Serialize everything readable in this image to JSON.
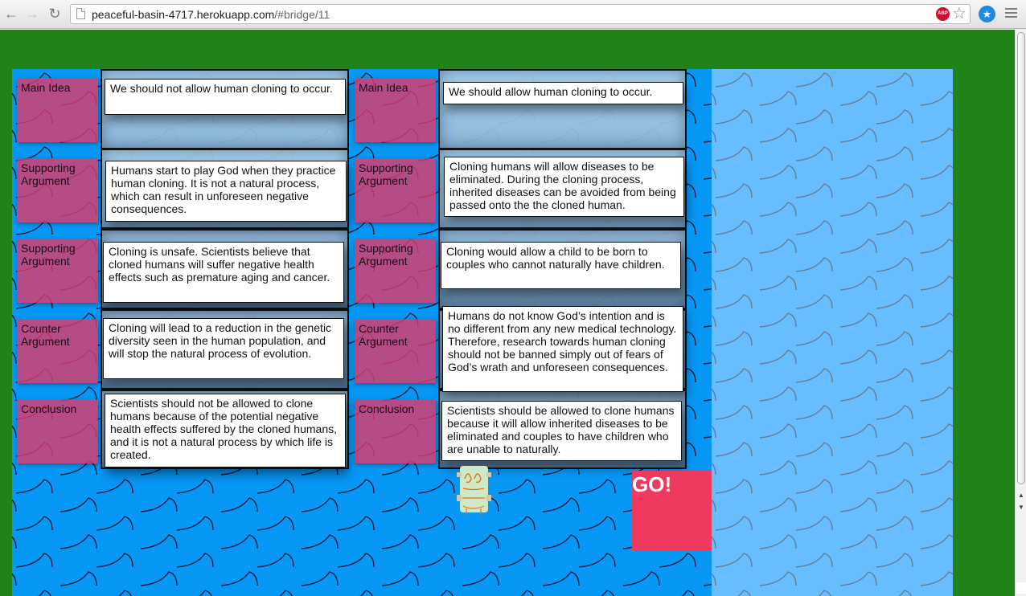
{
  "browser": {
    "url_host": "peaceful-basin-4717.herokuapp.com",
    "url_path": "/#bridge/11",
    "back_icon": "arrow-left",
    "forward_icon": "arrow-right",
    "reload_icon": "reload",
    "adblock_label": "ABP",
    "bookmark_icon": "star",
    "extension_icon": "star-badge",
    "menu_icon": "hamburger"
  },
  "game": {
    "go_label": "GO!",
    "colors": {
      "grass": "#208318",
      "water": "#0797f5",
      "water_light": "#67bdfd",
      "label_card": "#dc3c6e",
      "go_button": "#f0395f"
    },
    "columns": [
      {
        "side": "against",
        "rows": [
          {
            "label": "Main Idea",
            "text": "We should not allow human cloning to occur."
          },
          {
            "label": "Supporting Argument",
            "text": "Humans start to play God when they practice human cloning. It is not a natural process, which can result in unforeseen negative consequences."
          },
          {
            "label": "Supporting Argument",
            "text": "Cloning is unsafe. Scientists believe that cloned humans will suffer negative health effects such as premature aging and cancer."
          },
          {
            "label": "Counter Argument",
            "text": "Cloning will lead to a reduction in the genetic diversity seen in the human population, and will stop the natural process of evolution."
          },
          {
            "label": "Conclusion",
            "text": "Scientists should not be allowed to clone humans because of the potential negative health effects suffered by the cloned humans, and it is not a natural process by which life is created."
          }
        ]
      },
      {
        "side": "for",
        "rows": [
          {
            "label": "Main Idea",
            "text": "We should allow human cloning to occur."
          },
          {
            "label": "Supporting Argument",
            "text": "Cloning humans will allow diseases to be eliminated. During the cloning process, inherited diseases can be avoided from being passed onto the the cloned human."
          },
          {
            "label": "Supporting Argument",
            "text": "Cloning would allow a child to be born to couples who cannot naturally have children."
          },
          {
            "label": "Counter Argument",
            "text": "Humans do not know God’s intention and is no different from any new medical technology. Therefore, research towards human cloning should not be banned simply out of fears of God’s wrath and unforeseen consequences."
          },
          {
            "label": "Conclusion",
            "text": "Scientists should be allowed to clone humans because it will allow inherited diseases to be eliminated and couples to have children who are unable to naturally."
          }
        ]
      }
    ]
  }
}
